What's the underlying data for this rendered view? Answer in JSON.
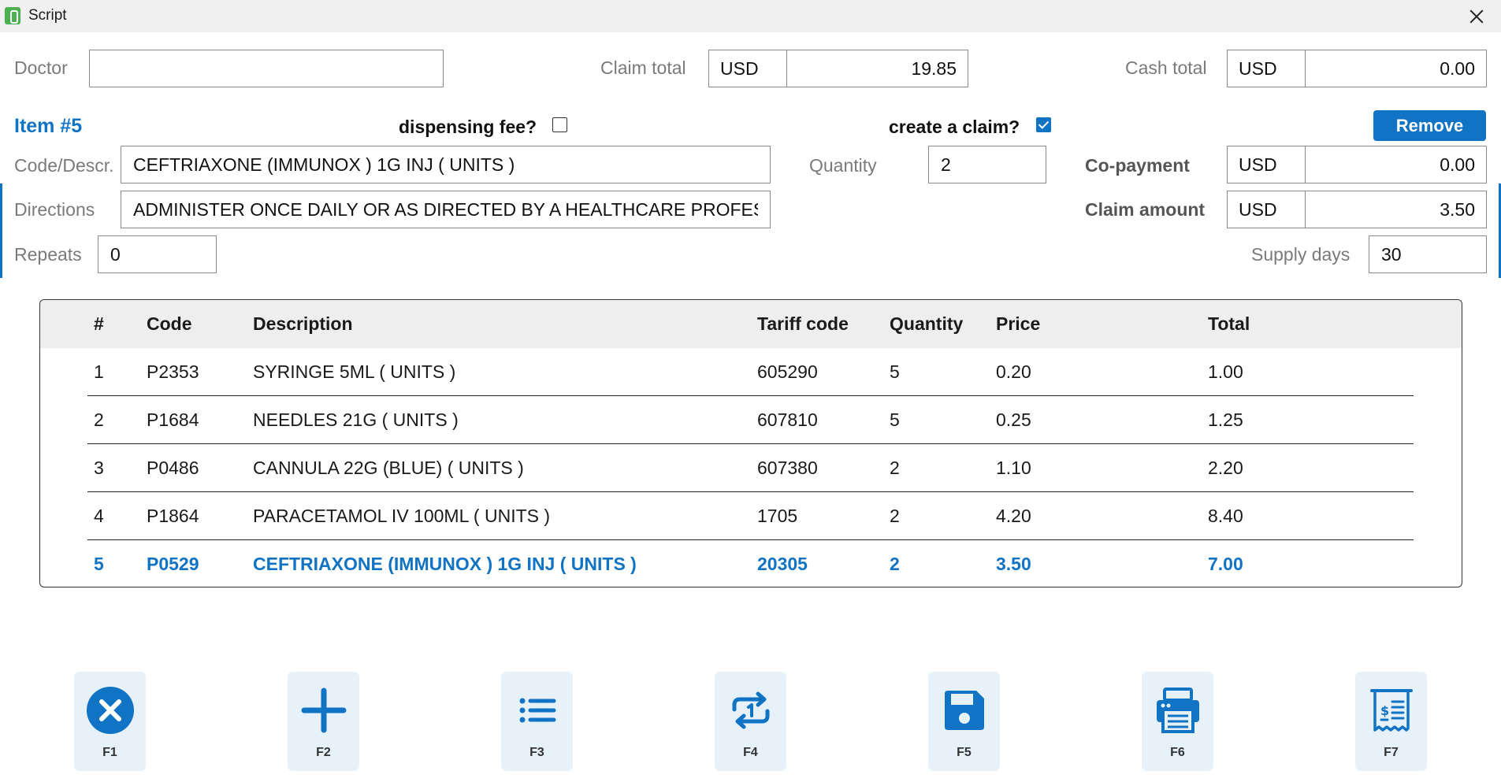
{
  "window": {
    "title": "Script"
  },
  "header": {
    "doctor_label": "Doctor",
    "doctor_value": "",
    "claim_total_label": "Claim total",
    "claim_total_currency": "USD",
    "claim_total_value": "19.85",
    "cash_total_label": "Cash total",
    "cash_total_currency": "USD",
    "cash_total_value": "0.00"
  },
  "item": {
    "title": "Item #5",
    "dispensing_fee_label": "dispensing fee?",
    "dispensing_fee_checked": false,
    "create_claim_label": "create a claim?",
    "create_claim_checked": true,
    "remove_label": "Remove",
    "code_label": "Code/Descr.",
    "code_value": "CEFTRIAXONE (IMMUNOX ) 1G INJ ( UNITS )",
    "quantity_label": "Quantity",
    "quantity_value": "2",
    "copayment_label": "Co-payment",
    "copayment_currency": "USD",
    "copayment_value": "0.00",
    "directions_label": "Directions",
    "directions_value": "ADMINISTER ONCE DAILY OR AS DIRECTED BY A HEALTHCARE PROFESSIOI",
    "claim_amount_label": "Claim amount",
    "claim_amount_currency": "USD",
    "claim_amount_value": "3.50",
    "repeats_label": "Repeats",
    "repeats_value": "0",
    "supply_days_label": "Supply days",
    "supply_days_value": "30"
  },
  "table": {
    "headers": {
      "num": "#",
      "code": "Code",
      "description": "Description",
      "tariff": "Tariff code",
      "quantity": "Quantity",
      "price": "Price",
      "total": "Total"
    },
    "rows": [
      {
        "num": "1",
        "code": "P2353",
        "description": "SYRINGE 5ML ( UNITS )",
        "tariff": "605290",
        "quantity": "5",
        "price": "0.20",
        "total": "1.00"
      },
      {
        "num": "2",
        "code": "P1684",
        "description": "NEEDLES 21G ( UNITS )",
        "tariff": "607810",
        "quantity": "5",
        "price": "0.25",
        "total": "1.25"
      },
      {
        "num": "3",
        "code": "P0486",
        "description": "CANNULA 22G (BLUE) ( UNITS )",
        "tariff": "607380",
        "quantity": "2",
        "price": "1.10",
        "total": "2.20"
      },
      {
        "num": "4",
        "code": "P1864",
        "description": "PARACETAMOL IV 100ML ( UNITS )",
        "tariff": "1705",
        "quantity": "2",
        "price": "4.20",
        "total": "8.40"
      },
      {
        "num": "5",
        "code": "P0529",
        "description": "CEFTRIAXONE (IMMUNOX ) 1G INJ ( UNITS )",
        "tariff": "20305",
        "quantity": "2",
        "price": "3.50",
        "total": "7.00"
      }
    ],
    "selected_index": 4
  },
  "function_keys": [
    {
      "label": "F1",
      "icon": "cancel-icon"
    },
    {
      "label": "F2",
      "icon": "add-icon"
    },
    {
      "label": "F3",
      "icon": "list-icon"
    },
    {
      "label": "F4",
      "icon": "repeat-once-icon"
    },
    {
      "label": "F5",
      "icon": "save-icon"
    },
    {
      "label": "F6",
      "icon": "print-icon"
    },
    {
      "label": "F7",
      "icon": "receipt-icon"
    }
  ],
  "colors": {
    "accent": "#1173c4",
    "header_bg": "#eeeeee",
    "fkey_bg": "#e6f1fa"
  }
}
